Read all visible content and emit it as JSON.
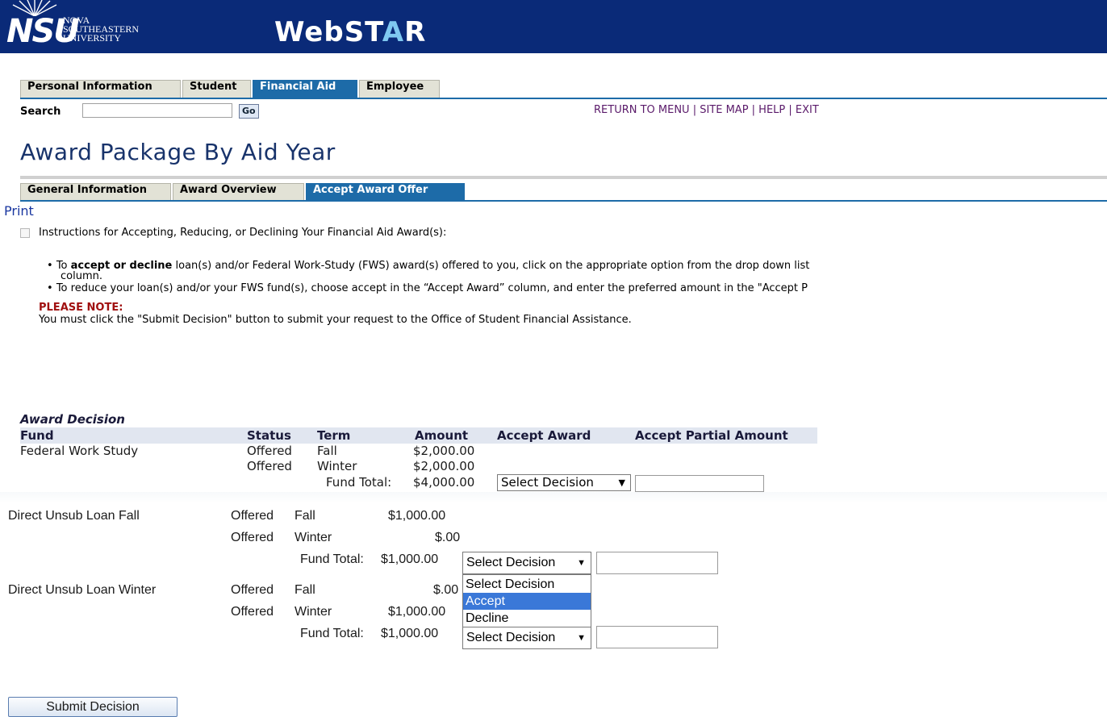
{
  "header": {
    "logo_mark": "NSU",
    "logo_lines": [
      "NOVA",
      "SOUTHEASTERN",
      "UNIVERSITY"
    ],
    "app_name_a": "WebST",
    "app_name_b": "A",
    "app_name_c": "R",
    "colors": {
      "banner": "#0a2a78",
      "tab_active": "#1d6ba8"
    }
  },
  "main_tabs": [
    "Personal Information",
    "Student",
    "Financial Aid",
    "Employee"
  ],
  "search": {
    "label": "Search",
    "value": "",
    "go_label": "Go"
  },
  "top_links": "RETURN TO MENU | SITE MAP | HELP | EXIT",
  "page_title": "Award Package By Aid Year",
  "sub_tabs": [
    "General Information",
    "Award Overview",
    "Accept Award Offer"
  ],
  "print_label": "Print",
  "instructions": {
    "title": "Instructions for Accepting, Reducing, or Declining Your Financial Aid Award(s):",
    "bullet1_pre": "To ",
    "bullet1_bold": "accept or decline",
    "bullet1_post": " loan(s) and/or Federal Work-Study (FWS) award(s) offered to you, click on the appropriate option from the drop down list",
    "bullet1_cont": "column.",
    "bullet2": "To reduce your loan(s) and/or your FWS fund(s), choose accept in the “Accept Award” column, and enter the preferred amount in the \"Accept P",
    "note_label": "PLEASE NOTE:",
    "note_text": "You must click the \"Submit Decision\" button to submit your request to the Office of Student Financial Assistance."
  },
  "award_decision": {
    "title": "Award Decision",
    "headers": [
      "Fund",
      "Status",
      "Term",
      "Amount",
      "Accept Award",
      "Accept Partial Amount"
    ],
    "funds": [
      {
        "name": "Federal Work Study",
        "rows": [
          {
            "status": "Offered",
            "term": "Fall",
            "amount": "$2,000.00"
          },
          {
            "status": "Offered",
            "term": "Winter",
            "amount": "$2,000.00"
          }
        ],
        "total_label": "Fund Total:",
        "total": "$4,000.00",
        "decision": "Select Decision"
      },
      {
        "name": "Direct Unsub Loan Fall",
        "rows": [
          {
            "status": "Offered",
            "term": "Fall",
            "amount": "$1,000.00"
          },
          {
            "status": "Offered",
            "term": "Winter",
            "amount": "$.00"
          }
        ],
        "total_label": "Fund Total:",
        "total": "$1,000.00",
        "decision": "Select Decision"
      },
      {
        "name": "Direct Unsub Loan Winter",
        "rows": [
          {
            "status": "Offered",
            "term": "Fall",
            "amount": "$.00"
          },
          {
            "status": "Offered",
            "term": "Winter",
            "amount": "$1,000.00"
          }
        ],
        "total_label": "Fund Total:",
        "total": "$1,000.00",
        "decision": "Select Decision"
      }
    ],
    "dropdown_options": [
      "Select Decision",
      "Accept",
      "Decline"
    ],
    "dropdown_highlighted": "Accept"
  },
  "submit_label": "Submit Decision"
}
